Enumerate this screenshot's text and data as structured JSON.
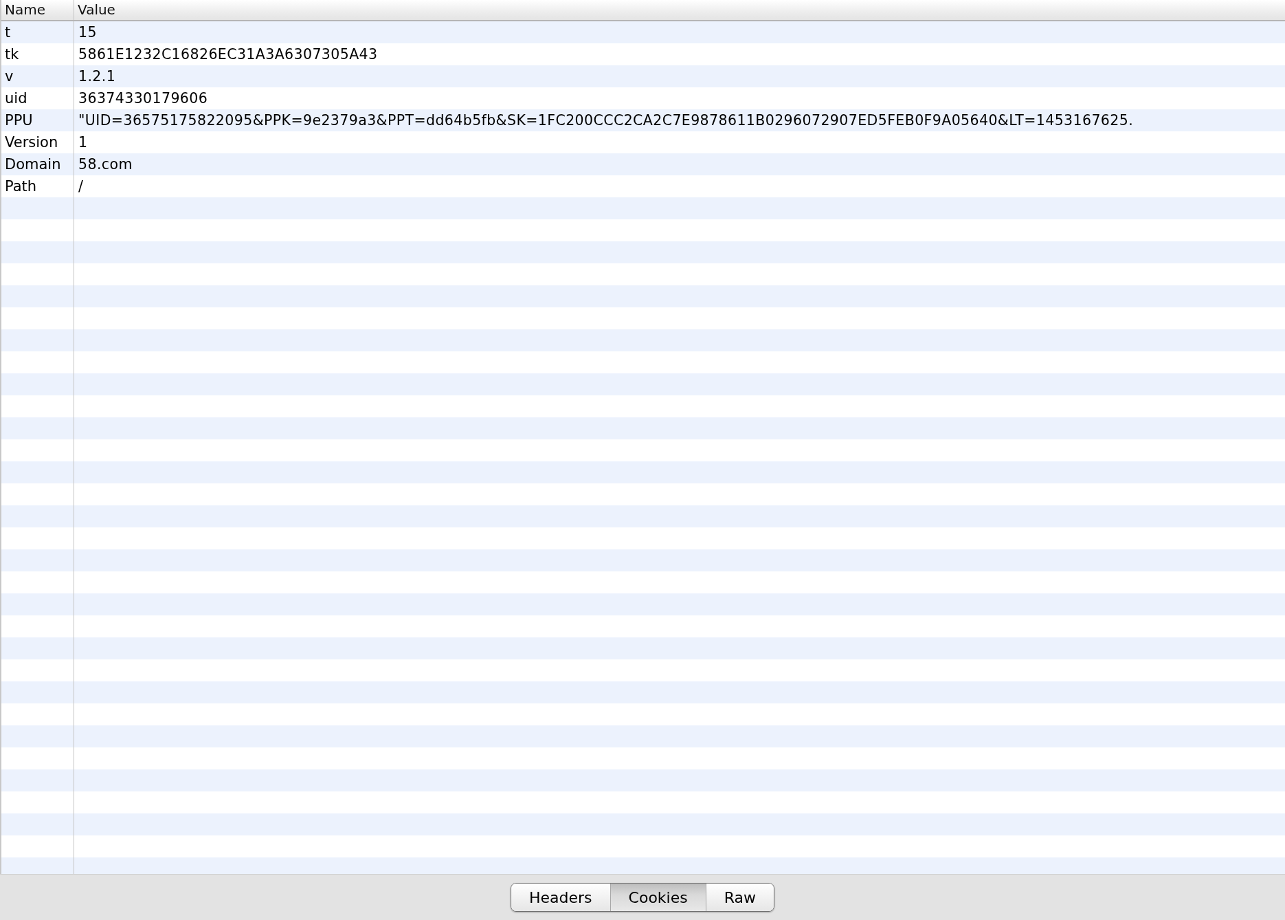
{
  "table": {
    "columns": [
      "Name",
      "Value"
    ],
    "rows": [
      {
        "name": "t",
        "value": "15"
      },
      {
        "name": "tk",
        "value": "5861E1232C16826EC31A3A6307305A43"
      },
      {
        "name": "v",
        "value": "1.2.1"
      },
      {
        "name": "uid",
        "value": "36374330179606"
      },
      {
        "name": "PPU",
        "value": "\"UID=36575175822095&PPK=9e2379a3&PPT=dd64b5fb&SK=1FC200CCC2CA2C7E9878611B0296072907ED5FEB0F9A05640&LT=1453167625."
      },
      {
        "name": "Version",
        "value": "1"
      },
      {
        "name": "Domain",
        "value": "58.com"
      },
      {
        "name": "Path",
        "value": "/"
      }
    ]
  },
  "tabs": [
    {
      "label": "Headers",
      "selected": false
    },
    {
      "label": "Cookies",
      "selected": true
    },
    {
      "label": "Raw",
      "selected": false
    }
  ]
}
